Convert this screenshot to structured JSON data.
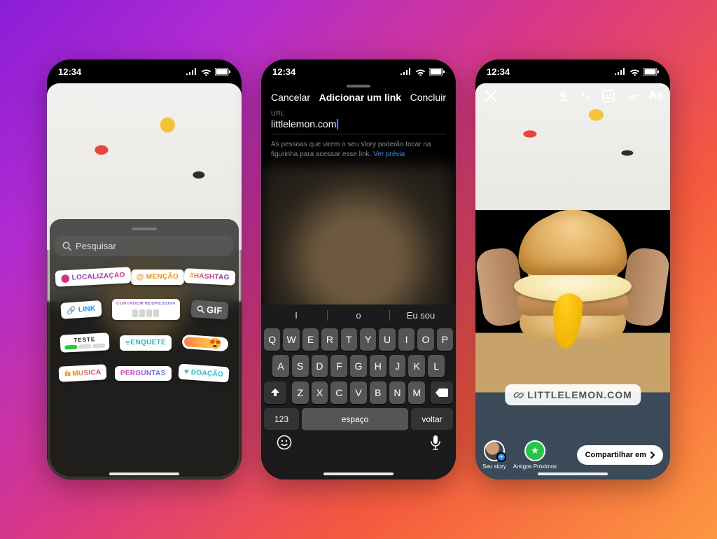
{
  "status": {
    "time": "12:34"
  },
  "screen1": {
    "search_placeholder": "Pesquisar",
    "stickers": {
      "location": "LOCALIZAÇÃO",
      "mention": "MENÇÃO",
      "hashtag": "#HASHTAG",
      "link": "LINK",
      "countdown": "CONTAGEM REGRESSIVA",
      "gif": "GIF",
      "test": "TESTE",
      "poll": "ENQUETE",
      "music": "MÚSICA",
      "questions": "PERGUNTAS",
      "donation": "DOAÇÃO"
    }
  },
  "screen2": {
    "cancel": "Cancelar",
    "title": "Adicionar um link",
    "done": "Concluir",
    "field_label": "URL",
    "field_value": "littlelemon.com",
    "help_text": "As pessoas que virem o seu story poderão tocar na figurinha para acessar esse link. ",
    "preview": "Ver prévia",
    "suggestions": [
      "I",
      "o",
      "Eu sou"
    ],
    "keyboard": {
      "row1": [
        "Q",
        "W",
        "E",
        "R",
        "T",
        "Y",
        "U",
        "I",
        "O",
        "P"
      ],
      "row2": [
        "A",
        "S",
        "D",
        "F",
        "G",
        "H",
        "J",
        "K",
        "L"
      ],
      "row3": [
        "Z",
        "X",
        "C",
        "V",
        "B",
        "N",
        "M"
      ],
      "n123": "123",
      "space": "espaço",
      "return": "voltar"
    }
  },
  "screen3": {
    "link_sticker": "LITTLELEMON.COM",
    "your_story": "Seu story",
    "close_friends": "Amigos Próximos",
    "share": "Compartilhar em",
    "tool_text": "Aa"
  }
}
